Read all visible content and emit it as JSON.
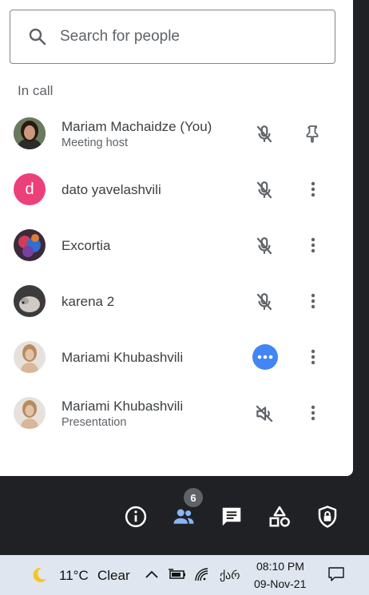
{
  "search": {
    "placeholder": "Search for people"
  },
  "section": {
    "label": "In call"
  },
  "people": [
    {
      "name": "Mariam Machaidze (You)",
      "subtitle": "Meeting host",
      "mic": "mic-off",
      "action": "pin"
    },
    {
      "name": "dato yavelashvili",
      "avatar_letter": "d",
      "mic": "mic-off",
      "action": "more"
    },
    {
      "name": "Excortia",
      "mic": "mic-off",
      "action": "more"
    },
    {
      "name": "karena 2",
      "mic": "mic-off",
      "action": "more"
    },
    {
      "name": "Mariami Khubashvili",
      "mic": "speaking",
      "action": "more"
    },
    {
      "name": "Mariami Khubashvili",
      "subtitle": "Presentation",
      "mic": "volume-off",
      "action": "more"
    }
  ],
  "toolbar": {
    "participants_count": "6",
    "icons": [
      "info-icon",
      "people-icon",
      "chat-icon",
      "activities-icon",
      "host-controls-icon"
    ],
    "active_color": "#8ab4f8"
  },
  "taskbar": {
    "temperature": "11°C",
    "weather": "Clear",
    "language": "ქარ",
    "time": "08:10 PM",
    "date": "09-Nov-21"
  }
}
